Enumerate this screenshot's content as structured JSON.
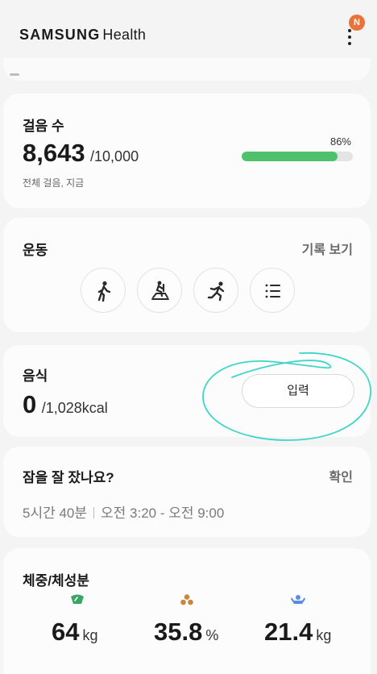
{
  "header": {
    "brand_bold": "SAMSUNG",
    "brand_rest": "Health",
    "avatar_letter": "N"
  },
  "steps": {
    "title": "걸음 수",
    "value": "8,643",
    "goal": "/10,000",
    "percent_label": "86%",
    "progress": 0.86,
    "subtitle": "전체 걸음, 지금",
    "accent": "#4fc16c"
  },
  "exercise": {
    "title": "운동",
    "link": "기록 보기",
    "buttons": [
      "walking-icon",
      "exercise-bike-icon",
      "running-icon",
      "list-icon"
    ]
  },
  "food": {
    "title": "음식",
    "value": "0",
    "goal": "/1,028kcal",
    "button": "입력"
  },
  "sleep": {
    "title": "잠을 잘 잤나요?",
    "link": "확인",
    "duration": "5시간 40분",
    "range": "오전 3:20 - 오전 9:00"
  },
  "body": {
    "title": "체중/체성분",
    "metrics": [
      {
        "value": "64",
        "unit": "kg",
        "icon": "weight-icon",
        "color": "#3aa566"
      },
      {
        "value": "35.8",
        "unit": "%",
        "icon": "body-fat-icon",
        "color": "#c9873c"
      },
      {
        "value": "21.4",
        "unit": "kg",
        "icon": "muscle-icon",
        "color": "#5b8be8"
      }
    ]
  }
}
